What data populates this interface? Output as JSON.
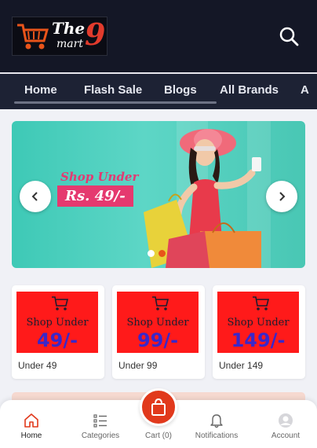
{
  "brand": {
    "name": "The",
    "sub": "mart",
    "number": "9"
  },
  "nav": {
    "items": [
      "Home",
      "Flash Sale",
      "Blogs",
      "All Brands",
      "A"
    ]
  },
  "banner": {
    "promo_line1": "Shop Under",
    "promo_line2": "Rs. 49/-",
    "slide_count": 2,
    "active_slide": 2
  },
  "cards": [
    {
      "shop_text": "Shop Under",
      "price": "49/-",
      "label": "Under 49"
    },
    {
      "shop_text": "Shop Under",
      "price": "99/-",
      "label": "Under 99"
    },
    {
      "shop_text": "Shop Under",
      "price": "149/-",
      "label": "Under 149"
    }
  ],
  "tabbar": {
    "items": [
      "Home",
      "Categories",
      "Cart (0)",
      "Notifications",
      "Account"
    ],
    "active": "Home"
  },
  "colors": {
    "accent": "#e1391c",
    "header_bg": "#141726",
    "nav_bg": "#1d2234",
    "card_red": "#ff1a1a",
    "price_blue": "#3a27c9"
  },
  "icons": {
    "search": "search-icon",
    "cart": "shopping-bag-icon",
    "home": "home-icon",
    "categories": "list-icon",
    "notifications": "bell-icon",
    "account": "user-avatar-icon",
    "prev": "chevron-left-icon",
    "next": "chevron-right-icon"
  }
}
